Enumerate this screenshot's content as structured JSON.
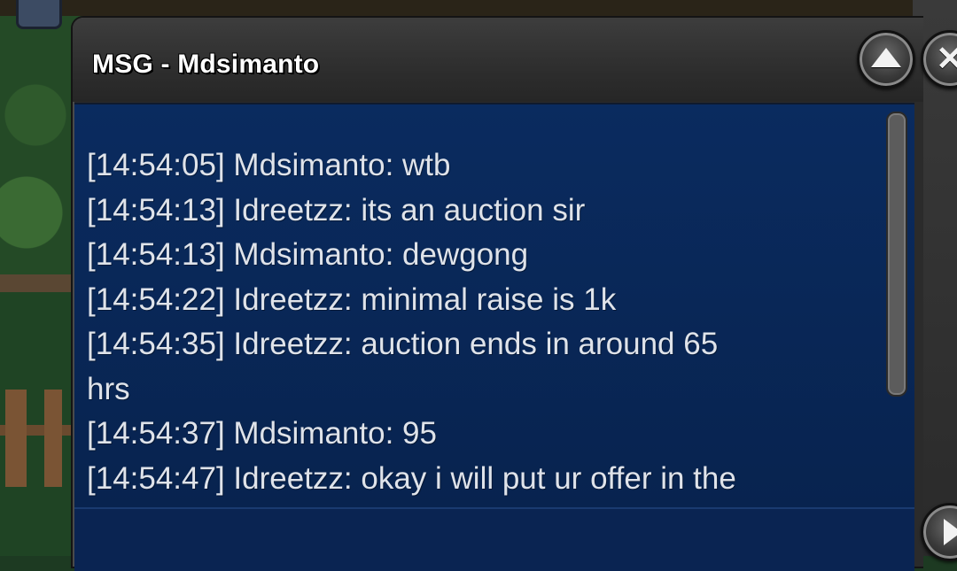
{
  "window": {
    "title": "MSG - Mdsimanto"
  },
  "controls": {
    "minimize_icon": "triangle-up",
    "close_icon": "x",
    "next_icon": "triangle-right"
  },
  "chat": {
    "messages": [
      "[14:54:05] Mdsimanto: wtb",
      "[14:54:13] Idreetzz: its an auction sir",
      "[14:54:13] Mdsimanto: dewgong",
      "[14:54:22] Idreetzz: minimal raise is 1k",
      "[14:54:35] Idreetzz: auction ends in around 65",
      "hrs",
      "[14:54:37] Mdsimanto: 95",
      "[14:54:47] Idreetzz: okay i will put ur offer in the"
    ]
  },
  "colors": {
    "chat_background": "#0a2b5f",
    "chat_text": "#dfe3ea",
    "title_text": "#ffffff",
    "window_frame": "#2b2b2b"
  }
}
